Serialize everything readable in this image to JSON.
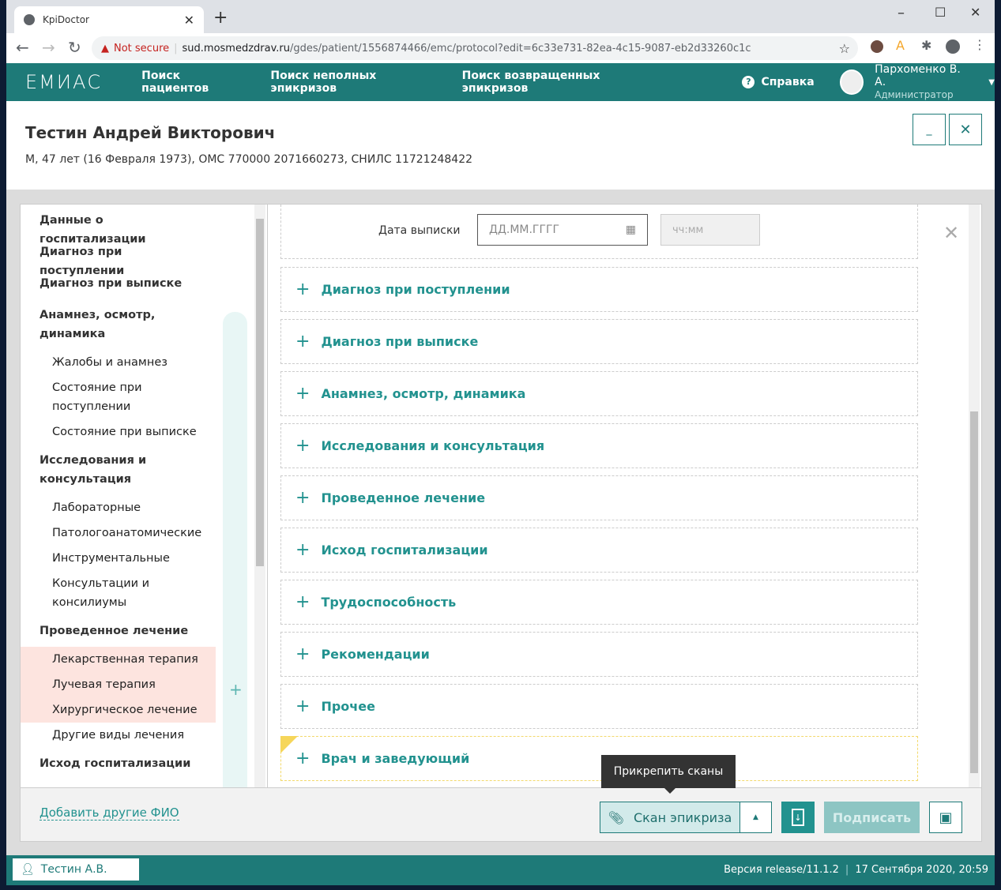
{
  "browser": {
    "tab_title": "KpiDoctor",
    "security": "Not secure",
    "url_host": "sud.mosmedzdrav.ru",
    "url_path": "/gdes/patient/1556874466/emc/protocol?edit=6c33e731-82ea-4c15-9087-eb2d33260c1c"
  },
  "app": {
    "logo": "ЕМИАС",
    "nav": [
      "Поиск пациентов",
      "Поиск неполных эпикризов",
      "Поиск возвращенных эпикризов"
    ],
    "help": "Справка",
    "user_name": "Пархоменко В. А.",
    "user_role": "Администратор"
  },
  "patient": {
    "name": "Тестин Андрей Викторович",
    "details": "М, 47 лет (16 Февраля 1973), ОМС 770000 2071660273, СНИЛС 11721248422"
  },
  "sidebar": {
    "items": [
      {
        "label": "Данные о госпитализации",
        "level": 1
      },
      {
        "label": "Диагноз при поступлении",
        "level": 1
      },
      {
        "label": "Диагноз при выписке",
        "level": 1
      },
      {
        "label": "Анамнез, осмотр, динамика",
        "level": 1
      },
      {
        "label": "Жалобы и анамнез",
        "level": 2
      },
      {
        "label": "Состояние при поступлении",
        "level": 2
      },
      {
        "label": "Состояние при выписке",
        "level": 2
      },
      {
        "label": "Исследования и консультация",
        "level": 1
      },
      {
        "label": "Лабораторные",
        "level": 2
      },
      {
        "label": "Патологоанатомические",
        "level": 2
      },
      {
        "label": "Инструментальные",
        "level": 2
      },
      {
        "label": "Консультации и консилиумы",
        "level": 2
      },
      {
        "label": "Проведенное лечение",
        "level": 1
      },
      {
        "label": "Лекарственная терапия",
        "level": 2,
        "highlighted": true
      },
      {
        "label": "Лучевая терапия",
        "level": 2,
        "highlighted": true
      },
      {
        "label": "Хирургическое лечение",
        "level": 2,
        "highlighted": true
      },
      {
        "label": "Другие виды лечения",
        "level": 2
      },
      {
        "label": "Исход госпитализации",
        "level": 1
      }
    ]
  },
  "form": {
    "discharge_date_label": "Дата выписки",
    "date_placeholder": "ДД.ММ.ГГГГ",
    "time_placeholder": "чч:мм"
  },
  "sections": [
    "Диагноз при поступлении",
    "Диагноз при выписке",
    "Анамнез, осмотр, динамика",
    "Исследования и консультация",
    "Проведенное лечение",
    "Исход госпитализации",
    "Трудоспособность",
    "Рекомендации",
    "Прочее",
    "Врач и заведующий"
  ],
  "footer": {
    "add_names": "Добавить другие ФИО",
    "tooltip": "Прикрепить сканы",
    "scan_button": "Скан эпикриза",
    "sign_button": "Подписать"
  },
  "statusbar": {
    "user": "Тестин А.В.",
    "version": "Версия release/11.1.2",
    "datetime": "17 Сентября 2020, 20:59"
  },
  "colors": {
    "teal": "#1e7a78",
    "accent": "#22928f",
    "highlight": "#fde4df"
  }
}
